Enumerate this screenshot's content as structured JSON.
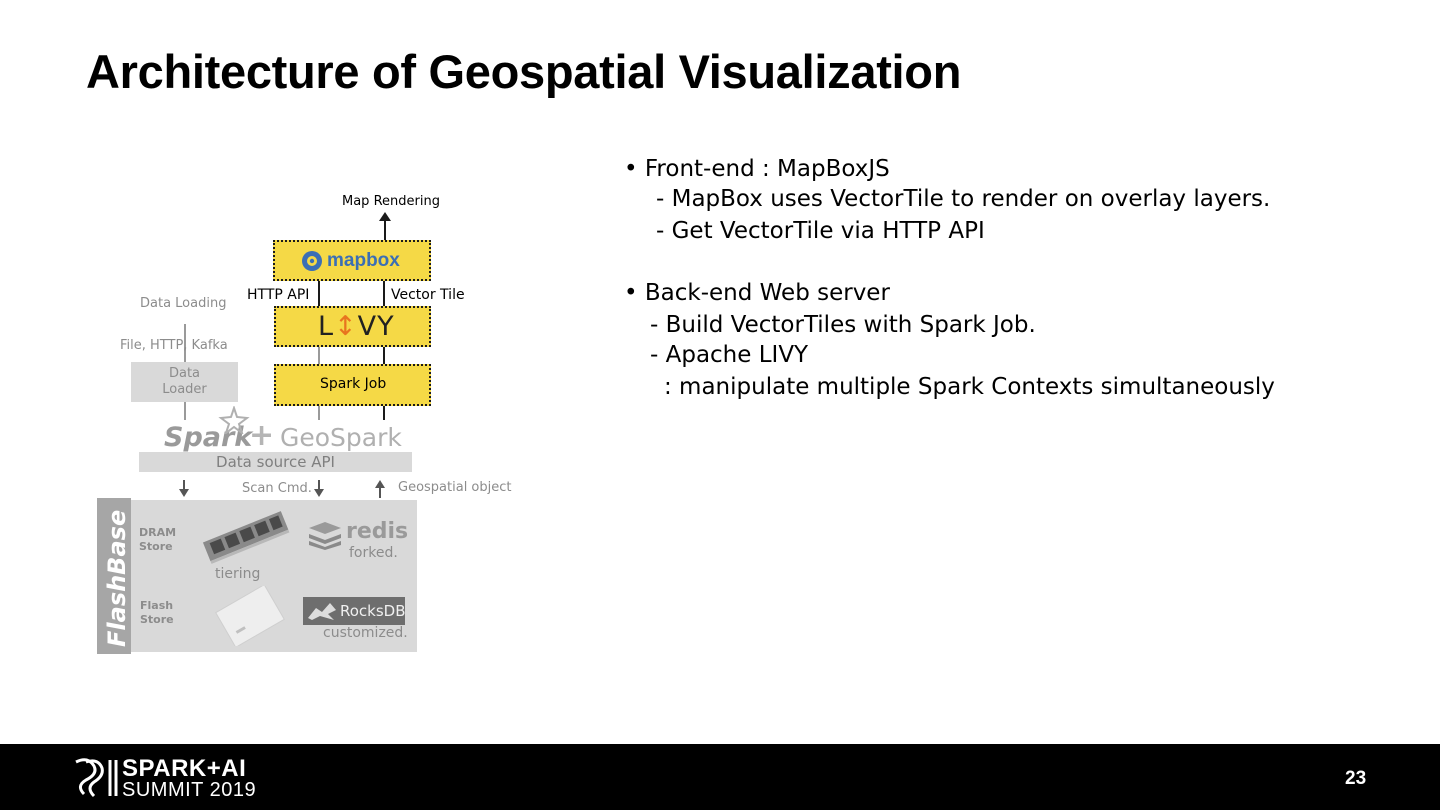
{
  "slide": {
    "title": "Architecture of Geospatial Visualization",
    "page_number": "23"
  },
  "diagram": {
    "map_rendering": "Map Rendering",
    "mapbox_logo": "mapbox",
    "http_api": "HTTP API",
    "vector_tile": "Vector Tile",
    "livy_left": "L",
    "livy_arrow": "↕",
    "livy_right": "VY",
    "spark_job": "Spark Job",
    "data_loading": "Data Loading",
    "file_http_kafka": "File, HTTP, Kafka",
    "data_loader_line1": "Data",
    "data_loader_line2": "Loader",
    "spark_logo": "Spark",
    "plus": "+",
    "geospark": "GeoSpark",
    "data_source_api": "Data source API",
    "scan_cmd": "Scan Cmd.",
    "geospatial_object": "Geospatial object",
    "flashbase": "FlashBase",
    "dram_store_line1": "DRAM",
    "dram_store_line2": "Store",
    "flash_store_line1": "Flash",
    "flash_store_line2": "Store",
    "redis": "redis",
    "forked": "forked.",
    "tiering": "tiering",
    "rocksdb": "RocksDB",
    "customized": "customized."
  },
  "bullets": {
    "frontend": "• Front-end : MapBoxJS",
    "frontend_sub1": "-  MapBox uses VectorTile to render on overlay layers.",
    "frontend_sub2": "-  Get VectorTile via HTTP API",
    "backend": "• Back-end Web server",
    "backend_sub1": "- Build VectorTiles with Spark Job.",
    "backend_sub2": "- Apache LIVY",
    "backend_sub3": ": manipulate multiple Spark Contexts simultaneously"
  },
  "footer": {
    "brand_line1": "SPARK+AI",
    "brand_line2": "SUMMIT 2019"
  },
  "colors": {
    "accent_yellow": "#f5d946",
    "mapbox_blue": "#3b6fb5",
    "livy_orange": "#e8741f",
    "footer_black": "#000000"
  }
}
